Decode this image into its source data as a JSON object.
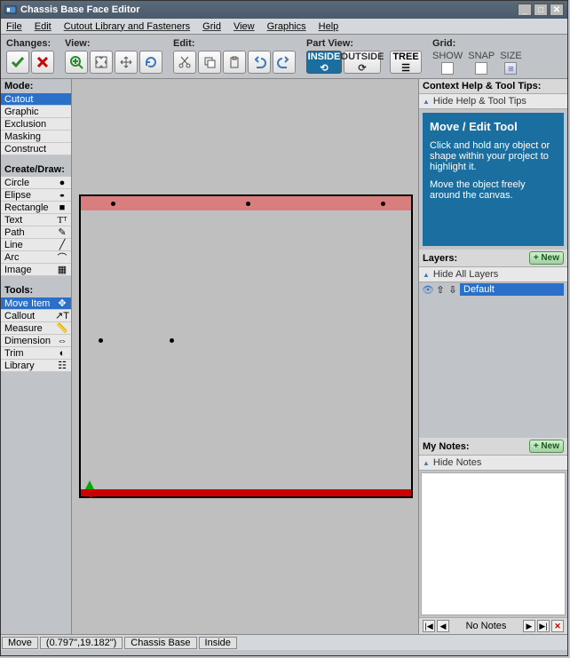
{
  "window": {
    "title": "Chassis Base Face Editor"
  },
  "menubar": [
    "File",
    "Edit",
    "Cutout Library and Fasteners",
    "Grid",
    "View",
    "Graphics",
    "Help"
  ],
  "toolbar": {
    "changes": "Changes:",
    "view": "View:",
    "edit": "Edit:",
    "partview": "Part View:",
    "inside": "INSIDE",
    "outside": "OUTSIDE",
    "tree": "TREE",
    "grid": "Grid:",
    "grid_opts": [
      "SHOW",
      "SNAP",
      "SIZE"
    ]
  },
  "left": {
    "mode_h": "Mode:",
    "modes": [
      "Cutout",
      "Graphic",
      "Exclusion",
      "Masking",
      "Construct"
    ],
    "create_h": "Create/Draw:",
    "create": [
      "Circle",
      "Elipse",
      "Rectangle",
      "Text",
      "Path",
      "Line",
      "Arc",
      "Image"
    ],
    "tools_h": "Tools:",
    "tools": [
      "Move Item",
      "Callout",
      "Measure",
      "Dimension",
      "Trim",
      "Library"
    ]
  },
  "right": {
    "context_h": "Context Help & Tool Tips:",
    "hide_tips": "Hide Help & Tool Tips",
    "tip_title": "Move / Edit Tool",
    "tip_p1": "Click and hold any object or shape within your project to highlight it.",
    "tip_p2": "Move the object freely around the canvas.",
    "layers_h": "Layers:",
    "new_btn": "+ New",
    "hide_layers": "Hide All Layers",
    "layer_default": "Default",
    "notes_h": "My Notes:",
    "hide_notes": "Hide Notes",
    "no_notes": "No Notes"
  },
  "status": {
    "mode": "Move",
    "coords": "(0.797\",19.182\")",
    "part": "Chassis Base",
    "side": "Inside"
  }
}
